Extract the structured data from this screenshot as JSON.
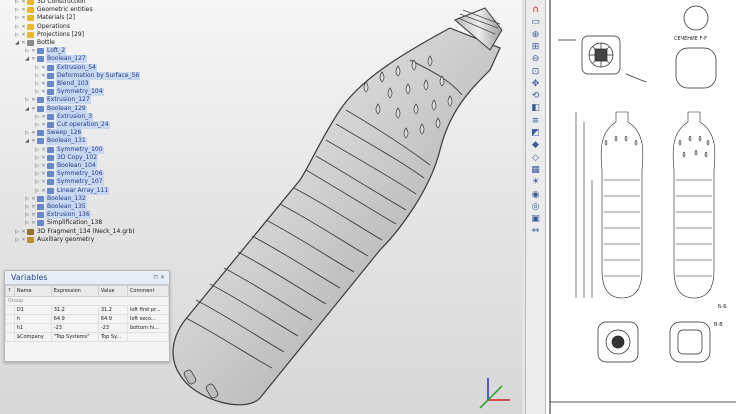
{
  "tree": {
    "items": [
      {
        "label": "3D Construction",
        "indent": 0,
        "icon": "folder",
        "expand": "▷"
      },
      {
        "label": "Geometric entities",
        "indent": 0,
        "icon": "folder",
        "expand": "▷"
      },
      {
        "label": "Materials [2]",
        "indent": 0,
        "icon": "folder",
        "expand": "▷"
      },
      {
        "label": "Operations",
        "indent": 0,
        "icon": "folder",
        "expand": "▷"
      },
      {
        "label": "Projections [29]",
        "indent": 0,
        "icon": "folder",
        "expand": "▷"
      },
      {
        "label": "Bottle",
        "indent": 0,
        "icon": "body",
        "expand": "◢"
      },
      {
        "label": "Loft_2",
        "indent": 1,
        "icon": "op",
        "expand": "▷",
        "sel": true
      },
      {
        "label": "Boolean_127",
        "indent": 1,
        "icon": "op",
        "expand": "◢",
        "sel": true
      },
      {
        "label": "Extrusion_54",
        "indent": 2,
        "icon": "op",
        "expand": "▷",
        "sel": true
      },
      {
        "label": "Deformation by Surface_56",
        "indent": 2,
        "icon": "op",
        "expand": "▷",
        "sel": true
      },
      {
        "label": "Blend_103",
        "indent": 2,
        "icon": "op",
        "expand": "▷",
        "sel": true
      },
      {
        "label": "Symmetry_104",
        "indent": 2,
        "icon": "op",
        "expand": "▷",
        "sel": true
      },
      {
        "label": "Extrusion_127",
        "indent": 1,
        "icon": "op",
        "expand": "▷",
        "sel": true
      },
      {
        "label": "Boolean_129",
        "indent": 1,
        "icon": "op",
        "expand": "◢",
        "sel": true
      },
      {
        "label": "Extrusion_3",
        "indent": 2,
        "icon": "op",
        "expand": "▷",
        "sel": true
      },
      {
        "label": "Cut operation_24",
        "indent": 2,
        "icon": "op",
        "expand": "▷",
        "sel": true
      },
      {
        "label": "Sweep_126",
        "indent": 1,
        "icon": "op",
        "expand": "▷",
        "sel": true
      },
      {
        "label": "Boolean_131",
        "indent": 1,
        "icon": "op",
        "expand": "◢",
        "sel": true
      },
      {
        "label": "Symmetry_100",
        "indent": 2,
        "icon": "op",
        "expand": "▷",
        "sel": true
      },
      {
        "label": "3D Copy_102",
        "indent": 2,
        "icon": "op",
        "expand": "▷",
        "sel": true
      },
      {
        "label": "Boolean_104",
        "indent": 2,
        "icon": "op",
        "expand": "▷",
        "sel": true
      },
      {
        "label": "Symmetry_106",
        "indent": 2,
        "icon": "op",
        "expand": "▷",
        "sel": true
      },
      {
        "label": "Symmetry_107",
        "indent": 2,
        "icon": "op",
        "expand": "▷",
        "sel": true
      },
      {
        "label": "Linear Array_111",
        "indent": 2,
        "icon": "op",
        "expand": "▷",
        "sel": true
      },
      {
        "label": "Boolean_132",
        "indent": 1,
        "icon": "op",
        "expand": "▷",
        "sel": true
      },
      {
        "label": "Boolean_135",
        "indent": 1,
        "icon": "op",
        "expand": "▷",
        "sel": true
      },
      {
        "label": "Extrusion_136",
        "indent": 1,
        "icon": "op",
        "expand": "▷",
        "sel": true
      },
      {
        "label": "Simplification_138",
        "indent": 1,
        "icon": "op",
        "expand": "▷"
      },
      {
        "label": "3D Fragment_134 (Neck_14.grb)",
        "indent": 0,
        "icon": "frag",
        "expand": "▷"
      },
      {
        "label": "Auxiliary geometry",
        "indent": 0,
        "icon": "geo",
        "expand": "▷"
      }
    ]
  },
  "variables": {
    "title": "Variables",
    "controls": "⊓ ✕",
    "columns": [
      "?",
      "Name",
      "Expression",
      "Value",
      "Comment"
    ],
    "group": "Group",
    "rows": [
      {
        "name": "D1",
        "expr": "31.2",
        "value": "31.2",
        "comment": "loft first pr..."
      },
      {
        "name": "h",
        "expr": "64.9",
        "value": "64.9",
        "comment": "loft seco..."
      },
      {
        "name": "h1",
        "expr": "-23",
        "value": "-23",
        "comment": "bottom hi..."
      },
      {
        "name": "$Company",
        "expr": "\"Top Systems\"",
        "value": "Top Sy...",
        "comment": ""
      }
    ]
  },
  "toolbar": {
    "icons": [
      "magnet-icon",
      "select-icon",
      "zoom-in-icon",
      "zoom-window-icon",
      "zoom-out-icon",
      "zoom-all-icon",
      "pan-icon",
      "rotate-icon",
      "view-icon",
      "layers-icon",
      "section-icon",
      "shade-icon",
      "wire-icon",
      "hidden-icon",
      "light-icon",
      "material-icon",
      "camera-icon",
      "render-icon",
      "measure-icon"
    ]
  },
  "drawing": {
    "section_label": "СЕЧЕНИЕ F-F",
    "view_label": "Б-Б",
    "view_label2": "В-В"
  },
  "colors": {
    "selected_text": "#243a8a",
    "selected_bg": "#c8d8f0",
    "folder": "#e8b830"
  }
}
